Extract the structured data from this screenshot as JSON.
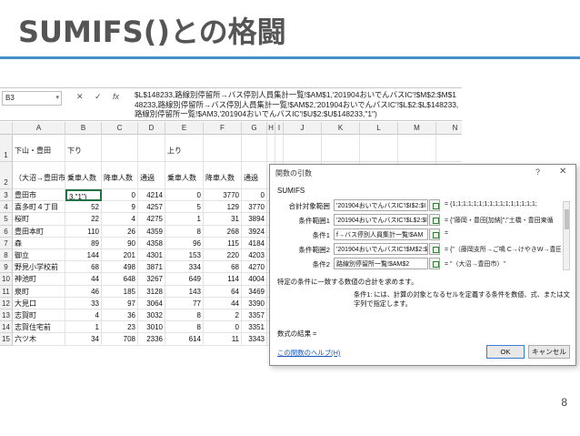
{
  "slide": {
    "title": "SUMIFS()との格闘",
    "number": "8"
  },
  "formula_bar": {
    "name_box": "B3",
    "cancel": "✕",
    "enter": "✓",
    "fx": "fx",
    "formula": "$L$148233,路線別停留所→バス停別人員集計一覧!$AM$1,'201904おいでんバスIC'!$M$2:$M$148233,路線別停留所→バス停別人員集計一覧!$AM$2,'201904おいでんバスIC'!$L$2:$L$148233,路線別停留所一覧!$AM3,'201904おいでんバスIC'!$U$2:$U$148233,\"1\")"
  },
  "sheet": {
    "columns": [
      "A",
      "B",
      "C",
      "D",
      "E",
      "F",
      "G",
      "H",
      "I",
      "J",
      "K",
      "L",
      "M",
      "N"
    ],
    "rows": [
      {
        "num": "1",
        "cells": {
          "A": "下山・豊田",
          "B": "下り",
          "E": "上り"
        }
      },
      {
        "num": "2",
        "cells": {
          "A": "（大沼→豊田市）",
          "B": "乗車人数",
          "C": "降車人数",
          "D": "通過",
          "E": "乗車人数",
          "F": "降車人数",
          "G": "通過"
        }
      },
      {
        "num": "3",
        "cells": {
          "A": "豊田市",
          "B": "3,\"1\")",
          "C": "0",
          "D": "4214",
          "E": "0",
          "F": "3770",
          "G": "0"
        }
      },
      {
        "num": "4",
        "cells": {
          "A": "喜多町４丁目",
          "B": "52",
          "C": "9",
          "D": "4257",
          "E": "5",
          "F": "129",
          "G": "3770"
        }
      },
      {
        "num": "5",
        "cells": {
          "A": "桜町",
          "B": "22",
          "C": "4",
          "D": "4275",
          "E": "1",
          "F": "31",
          "G": "3894"
        }
      },
      {
        "num": "6",
        "cells": {
          "A": "豊田本町",
          "B": "110",
          "C": "26",
          "D": "4359",
          "E": "8",
          "F": "268",
          "G": "3924"
        }
      },
      {
        "num": "7",
        "cells": {
          "A": "森",
          "B": "89",
          "C": "90",
          "D": "4358",
          "E": "96",
          "F": "115",
          "G": "4184"
        }
      },
      {
        "num": "8",
        "cells": {
          "A": "御立",
          "B": "144",
          "C": "201",
          "D": "4301",
          "E": "153",
          "F": "220",
          "G": "4203"
        }
      },
      {
        "num": "9",
        "cells": {
          "A": "野見小学校前",
          "B": "68",
          "C": "498",
          "D": "3871",
          "E": "334",
          "F": "68",
          "G": "4270"
        }
      },
      {
        "num": "10",
        "cells": {
          "A": "神池町",
          "B": "44",
          "C": "648",
          "D": "3267",
          "E": "649",
          "F": "114",
          "G": "4004"
        }
      },
      {
        "num": "11",
        "cells": {
          "A": "泉町",
          "B": "46",
          "C": "185",
          "D": "3128",
          "E": "143",
          "F": "64",
          "G": "3469"
        }
      },
      {
        "num": "12",
        "cells": {
          "A": "大見口",
          "B": "33",
          "C": "97",
          "D": "3064",
          "E": "77",
          "F": "44",
          "G": "3390"
        }
      },
      {
        "num": "13",
        "cells": {
          "A": "志賀町",
          "B": "4",
          "C": "36",
          "D": "3032",
          "E": "8",
          "F": "2",
          "G": "3357"
        }
      },
      {
        "num": "14",
        "cells": {
          "A": "志賀住宅前",
          "B": "1",
          "C": "23",
          "D": "3010",
          "E": "8",
          "F": "0",
          "G": "3351"
        }
      },
      {
        "num": "15",
        "cells": {
          "A": "六ツ木",
          "B": "34",
          "C": "708",
          "D": "2336",
          "E": "614",
          "F": "11",
          "G": "3343"
        }
      }
    ]
  },
  "dialog": {
    "title": "関数の引数",
    "help": "?",
    "close": "✕",
    "function_name": "SUMIFS",
    "args": [
      {
        "label": "合計対象範囲",
        "input": "'201904おいでんバスIC'!$I$2:$I",
        "value": "= {1;1;1;1;1;1;1;1;1;1;1;1;1;1;1;1;"
      },
      {
        "label": "条件範囲1",
        "input": "'201904おいでんバスIC'!$L$2:$l",
        "value": "= {\"藤岡・豊田[加納]\";\"土橋・豊田東循"
      },
      {
        "label": "条件1",
        "input": "f→バス停別人員集計一覧!$AM",
        "value": "="
      },
      {
        "label": "条件範囲2",
        "input": "'201904おいでんバスIC'!$M$2:$",
        "value": "= {\"（藤岡支所→ご鳴 C→けやきW→豊田"
      },
      {
        "label": "条件2",
        "input": "路線別停留所一覧!$AM$2",
        "value": "= \"（大沼→豊田市）\""
      }
    ],
    "description": "特定の条件に一致する数値の合計を求めます。",
    "arg_description": "条件1: には、計算の対象となるセルを定義する条件を数値、式、または文字列で指定します。",
    "result_label": "数式の結果 =",
    "help_link": "この関数のヘルプ(H)",
    "ok": "OK",
    "cancel": "キャンセル"
  }
}
